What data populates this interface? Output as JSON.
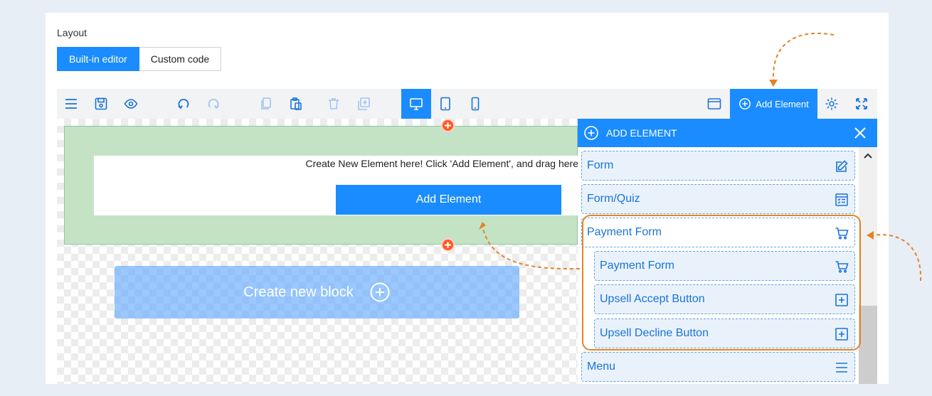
{
  "layout": {
    "label": "Layout",
    "modes": [
      "Built-in editor",
      "Custom code"
    ]
  },
  "toolbar": {
    "add_element_label": "Add Element"
  },
  "canvas": {
    "create_text": "Create New Element here! Click 'Add Element', and drag here",
    "add_element_button": "Add Element",
    "new_block_label": "Create new block"
  },
  "panel": {
    "title": "ADD ELEMENT",
    "items": [
      {
        "label": "Form",
        "icon": "edit-icon"
      },
      {
        "label": "Form/Quiz",
        "icon": "quiz-icon"
      },
      {
        "label": "Payment Form",
        "icon": "cart-icon"
      },
      {
        "label": "Payment Form",
        "icon": "cart-icon"
      },
      {
        "label": "Upsell Accept Button",
        "icon": "plus-square-icon"
      },
      {
        "label": "Upsell Decline Button",
        "icon": "plus-square-icon"
      },
      {
        "label": "Menu",
        "icon": "menu-lines-icon"
      }
    ]
  },
  "colors": {
    "accent": "#1a8cff",
    "annotation": "#e38426",
    "block_green": "#c4e3c4",
    "plus_dot": "#ff5722"
  }
}
